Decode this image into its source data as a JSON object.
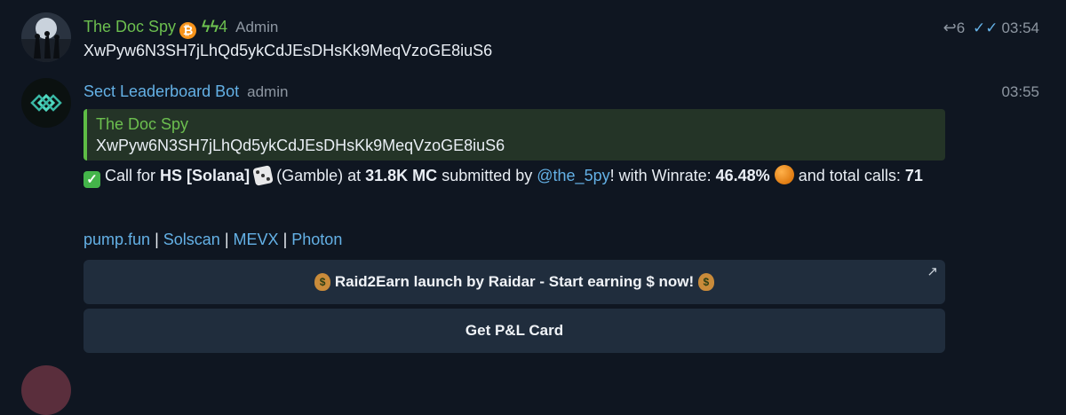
{
  "messages": [
    {
      "sender": "The Doc Spy",
      "sender_badge_icon": "bitcoin-icon",
      "boost_icon": "boost-icon",
      "boost_count": "4",
      "role": "Admin",
      "reply_count": "6",
      "time": "03:54",
      "text": "XwPyw6N3SH7jLhQd5ykCdJEsDHsKk9MeqVzoGE8iuS6"
    },
    {
      "sender": "Sect Leaderboard Bot",
      "role": "admin",
      "time": "03:55",
      "quoted": {
        "sender": "The Doc Spy",
        "text": "XwPyw6N3SH7jLhQd5ykCdJEsDHsKk9MeqVzoGE8iuS6"
      },
      "call": {
        "prefix": "Call for",
        "token": "HS [Solana]",
        "gamble": "(Gamble) at",
        "mc": "31.8K MC",
        "submitted_by": "submitted by",
        "user": "@the_5py",
        "winrate_label": "! with Winrate:",
        "winrate": "46.48%",
        "and_label": "and",
        "total_calls_label": "total calls:",
        "total_calls": "71"
      },
      "links": {
        "l1": "pump.fun",
        "l2": "Solscan",
        "l3": "MEVX",
        "l4": "Photon",
        "sep": "|"
      },
      "buttons": {
        "raid_label": "Raid2Earn launch by Raidar - Start earning $ now!",
        "pnl_label": "Get P&L Card"
      }
    }
  ],
  "colors": {
    "background": "#0f1621",
    "admin_name": "#6cbf4f",
    "bot_name": "#64b1e6",
    "button_bg": "#202d3d"
  }
}
